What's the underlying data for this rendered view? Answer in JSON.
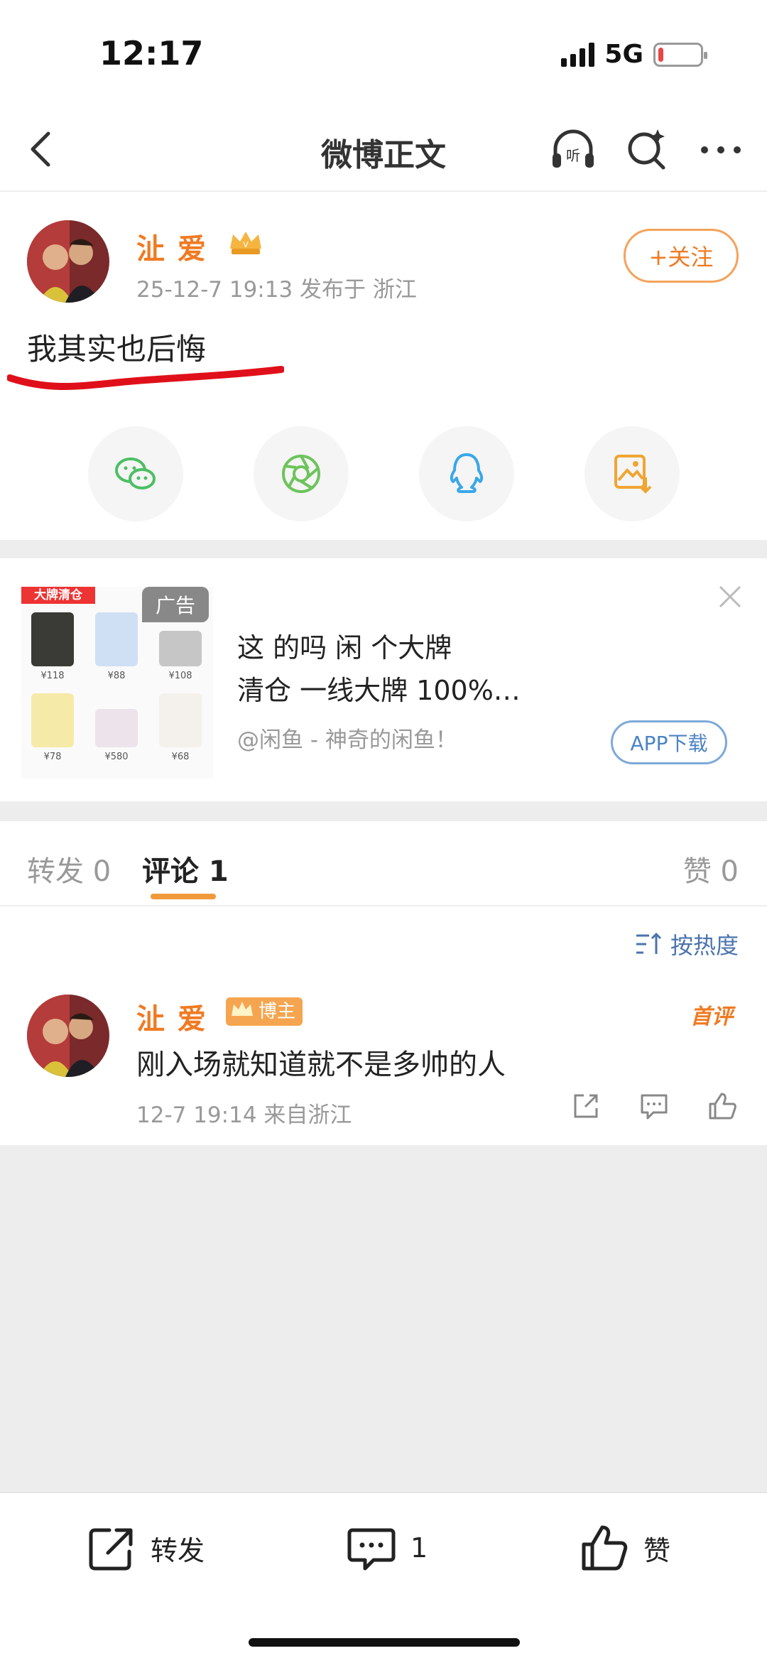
{
  "status_bar": {
    "time": "12:17",
    "network": "5G",
    "battery_level": 0.12
  },
  "nav": {
    "title": "微博正文",
    "icons": [
      "back-arrow-icon",
      "listen-icon",
      "search-icon",
      "more-icon"
    ]
  },
  "post": {
    "username": "沚 爱",
    "meta": "25-12-7 19:13  发布于 浙江",
    "follow_label": "+关注",
    "text": "我其实也后悔",
    "share_icons": [
      "wechat-icon",
      "moments-icon",
      "qq-icon",
      "save-image-icon"
    ]
  },
  "ad": {
    "label": "广告",
    "banner_tag": "大牌清仓",
    "products": [
      {
        "price": "¥118"
      },
      {
        "price": "¥88"
      },
      {
        "price": "¥108"
      },
      {
        "price": "¥78"
      },
      {
        "price": "¥580"
      },
      {
        "price": "¥68"
      }
    ],
    "title_line1": "这 的吗 闲 个大牌",
    "title_line2": "清仓 一线大牌 100%…",
    "source": "@闲鱼 - 神奇的闲鱼！",
    "app_button": "APP下载"
  },
  "tabs": {
    "repost": "转发 0",
    "comment": "评论 1",
    "like": "赞 0"
  },
  "comments": {
    "sort_label": "按热度",
    "items": [
      {
        "username": "沚 爱",
        "badge": "博主",
        "first_tag": "首评",
        "text": "刚入场就知道就不是多帅的人",
        "meta": "12-7 19:14  来自浙江"
      }
    ]
  },
  "bottom_bar": {
    "repost": "转发",
    "comment_count": "1",
    "like": "赞"
  },
  "colors": {
    "accent": "#f07a22",
    "link": "#4b74ad",
    "annotation": "#e0101a"
  }
}
